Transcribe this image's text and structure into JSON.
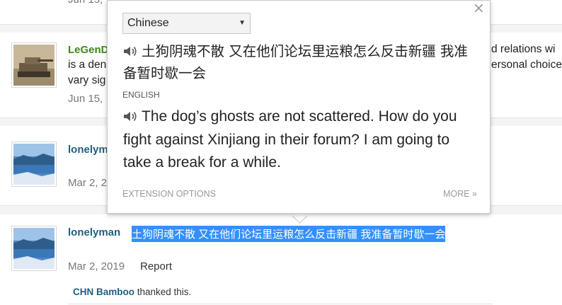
{
  "posts": [
    {
      "username": "LeGenD",
      "text_line1": "is a den",
      "text_line2": "vary sig",
      "right_line1": "d relations wi",
      "right_line2": "ersonal choice",
      "date": "Jun 15,"
    },
    {
      "username": "lonelym",
      "date": "Mar 2, 2"
    },
    {
      "username": "lonelyman",
      "selected_text": "土狗阴魂不散 又在他们论坛里运粮怎么反击新疆 我准备暂时歇一会",
      "date": "Mar 2, 2019",
      "report_label": "Report",
      "thanks_user": "CHN Bamboo",
      "thanks_text": " thanked this."
    }
  ],
  "top_date_fragment": "Jun 15,",
  "translator": {
    "source_language": "Chinese",
    "source_text": "土狗阴魂不散 又在他们论坛里运粮怎么反击新疆 我准备暂时歇一会",
    "target_language_label": "ENGLISH",
    "translated_text": "The dog’s ghosts are not scattered. How do you fight against Xinjiang in their forum? I am going to take a break for a while.",
    "options_link": "EXTENSION OPTIONS",
    "more_link": "MORE »",
    "close_glyph": "×",
    "select_arrow": "▼"
  }
}
